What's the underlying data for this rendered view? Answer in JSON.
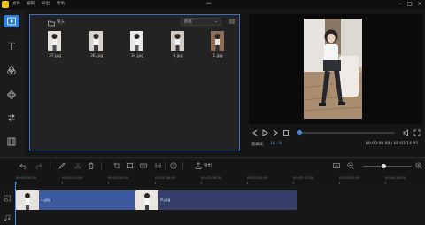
{
  "app": {
    "title": ".vs"
  },
  "menu": [
    "文件",
    "编辑",
    "导出",
    "帮助"
  ],
  "window_controls": [
    "minimize-icon",
    "maximize-icon",
    "close-icon"
  ],
  "toolstrip": [
    {
      "name": "media",
      "icon": "media-play-icon",
      "active": true
    },
    {
      "name": "text",
      "icon": "text-icon",
      "active": false
    },
    {
      "name": "filters",
      "icon": "filter-circles-icon",
      "active": false
    },
    {
      "name": "overlays",
      "icon": "overlay-diamond-icon",
      "active": false
    },
    {
      "name": "transitions",
      "icon": "transition-arrows-icon",
      "active": false
    },
    {
      "name": "elements",
      "icon": "film-icon",
      "active": false
    }
  ],
  "media_panel": {
    "import_label": "导入",
    "filter_value": "所有",
    "items": [
      {
        "file": "37.jpg"
      },
      {
        "file": "36.jpg"
      },
      {
        "file": "34.jpg"
      },
      {
        "file": "9.jpg"
      },
      {
        "file": "1.jpg"
      }
    ]
  },
  "preview": {
    "aspect_label": "宽高比",
    "aspect_value": "16 : 9",
    "timecode": "00:00:00.00 / 00:03:14.05",
    "progress": 0.02
  },
  "timeline": {
    "export_label": "导出",
    "ruler": [
      "00:00:00.00",
      "00:00:12.00",
      "00:01:04.00",
      "00:01:36.00",
      "00:02:08.00",
      "00:02:40.00",
      "00:03:12.00",
      "00:03:44.00",
      "00:04:16.00"
    ],
    "clips": [
      {
        "label": "1.jpg"
      },
      {
        "label": "9.jpg"
      }
    ],
    "zoom": 0.42
  },
  "colors": {
    "accent": "#2f7dd4",
    "clip_primary": "#3d5a9e",
    "clip_secondary": "#34406a"
  }
}
